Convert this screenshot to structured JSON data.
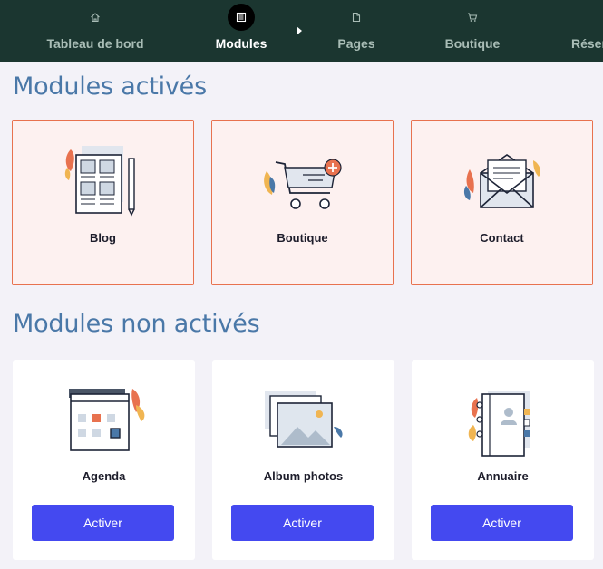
{
  "nav": {
    "items": [
      {
        "label": "Tableau de bord",
        "icon": "home-icon"
      },
      {
        "label": "Modules",
        "icon": "list-icon",
        "active": true
      },
      {
        "label": "Pages",
        "icon": "page-icon"
      },
      {
        "label": "Boutique",
        "icon": "cart-icon"
      },
      {
        "label": "Résen",
        "icon": "calendar-icon"
      }
    ]
  },
  "active_modules": {
    "title": "Modules activés",
    "items": [
      {
        "label": "Blog",
        "icon": "blog-illustration"
      },
      {
        "label": "Boutique",
        "icon": "shop-cart-illustration"
      },
      {
        "label": "Contact",
        "icon": "envelope-illustration"
      }
    ]
  },
  "inactive_modules": {
    "title": "Modules non activés",
    "button_label": "Activer",
    "items": [
      {
        "label": "Agenda",
        "icon": "calendar-illustration"
      },
      {
        "label": "Album photos",
        "icon": "photo-album-illustration"
      },
      {
        "label": "Annuaire",
        "icon": "address-book-illustration"
      }
    ]
  },
  "colors": {
    "nav_bg": "#1b3630",
    "heading": "#4a78a8",
    "active_card_bg": "#fdf1f0",
    "active_card_border": "#e8724f",
    "button": "#4449f0"
  }
}
